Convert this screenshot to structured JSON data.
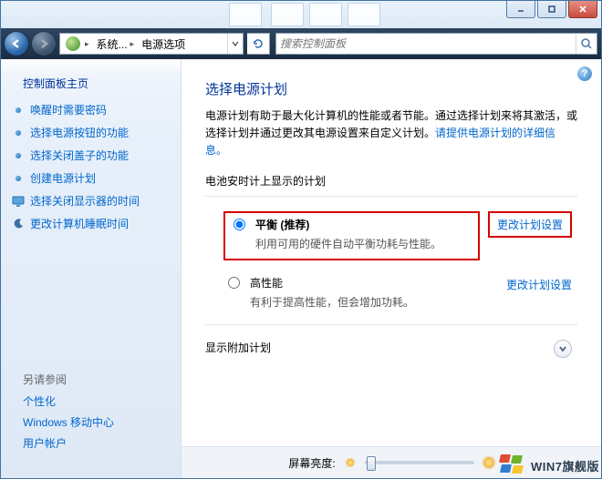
{
  "artifact_positions": [
    250,
    296,
    338,
    380
  ],
  "nav": {
    "breadcrumb_root": "系统...",
    "breadcrumb_current": "电源选项",
    "search_placeholder": "搜索控制面板"
  },
  "sidebar": {
    "heading": "控制面板主页",
    "items": [
      {
        "label": "唤醒时需要密码",
        "icon": "dot"
      },
      {
        "label": "选择电源按钮的功能",
        "icon": "dot"
      },
      {
        "label": "选择关闭盖子的功能",
        "icon": "dot"
      },
      {
        "label": "创建电源计划",
        "icon": "dot"
      },
      {
        "label": "选择关闭显示器的时间",
        "icon": "display"
      },
      {
        "label": "更改计算机睡眠时间",
        "icon": "moon"
      }
    ],
    "see_also_heading": "另请参阅",
    "see_also": [
      "个性化",
      "Windows 移动中心",
      "用户帐户"
    ]
  },
  "main": {
    "title": "选择电源计划",
    "description_1": "电源计划有助于最大化计算机的性能或者节能。通过选择计划来将其激活，或选择计划并通过更改其电源设置来自定义计划。",
    "description_link": "请提供电源计划的详细信息。",
    "section_battery": "电池安时计上显示的计划",
    "plans": [
      {
        "name": "平衡",
        "badge": " (推荐)",
        "sub": "利用可用的硬件自动平衡功耗与性能。",
        "link": "更改计划设置",
        "checked": true,
        "highlight": true
      },
      {
        "name": "高性能",
        "badge": "",
        "sub": "有利于提高性能，但会增加功耗。",
        "link": "更改计划设置",
        "checked": false,
        "highlight": false
      }
    ],
    "section_extra": "显示附加计划",
    "brightness_label": "屏幕亮度:",
    "help_char": "?"
  },
  "watermark": {
    "text": "WIN7旗舰版",
    "url": "www.win7qijian.com"
  }
}
